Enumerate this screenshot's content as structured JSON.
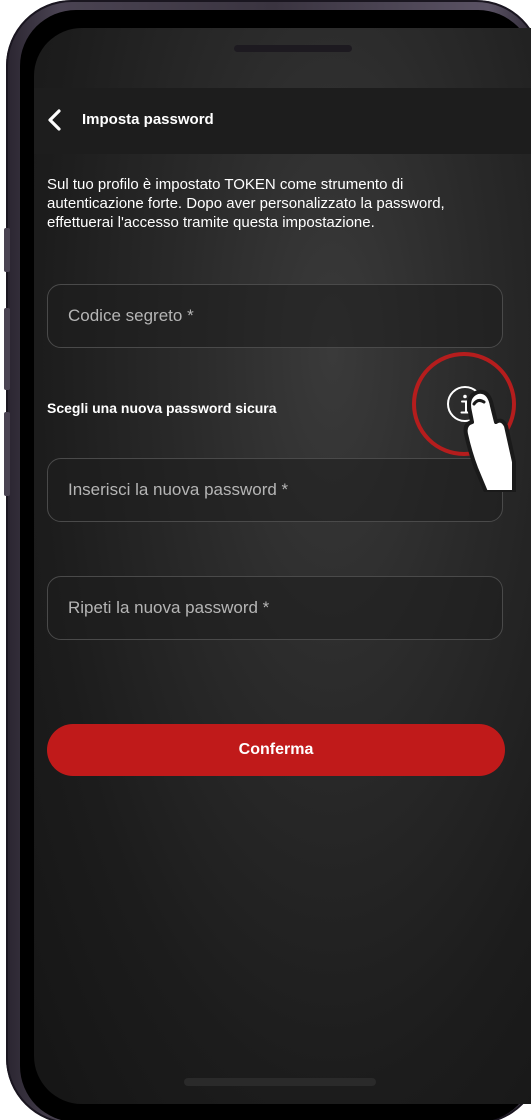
{
  "header": {
    "title": "Imposta password",
    "back_icon": "chevron-left-icon"
  },
  "intro": {
    "lines": [
      "Sul tuo profilo è impostato TOKEN come strumento di",
      "autenticazione forte. Dopo aver personalizzato la password,",
      "effettuerai l'accesso tramite questa impostazione."
    ]
  },
  "form": {
    "secret_code": {
      "value": "",
      "placeholder": "Codice segreto *"
    },
    "section_label": "Scegli una nuova password sicura",
    "info_icon": "info-icon",
    "new_password": {
      "value": "",
      "placeholder": "Inserisci la nuova password *"
    },
    "repeat_password": {
      "value": "",
      "placeholder": "Ripeti la nuova password *"
    },
    "confirm_label": "Conferma"
  },
  "overlay": {
    "highlight": "info-icon-highlight",
    "pointer": "hand-pointer-icon"
  },
  "colors": {
    "accent": "#c01a1a",
    "background": "#1e1e1e",
    "text": "#ffffff",
    "placeholder": "#b5b5b5"
  }
}
